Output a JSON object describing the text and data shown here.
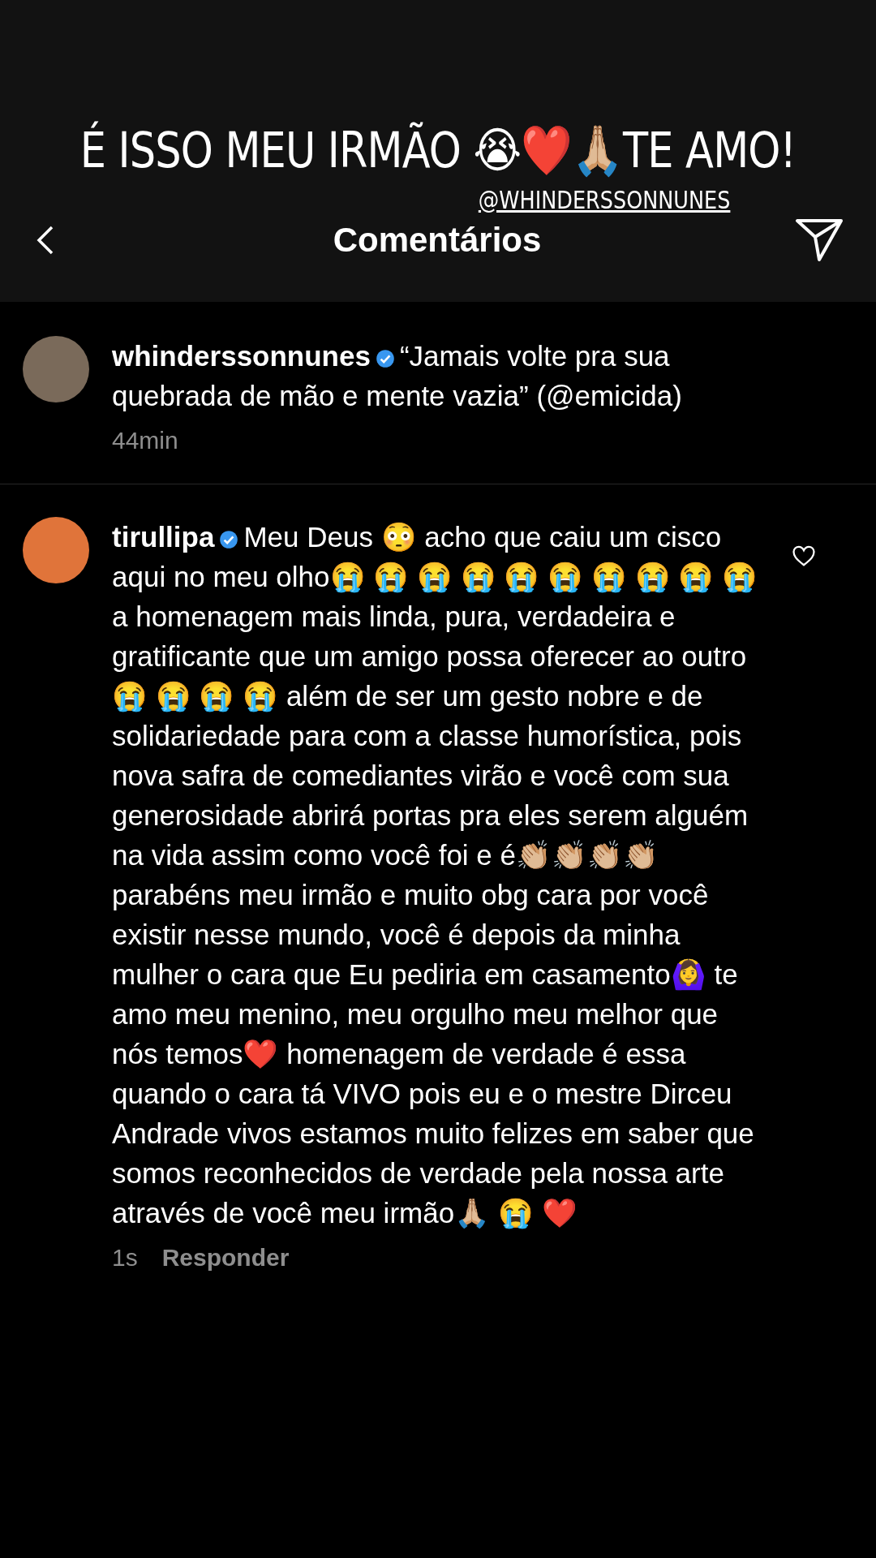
{
  "story": {
    "caption": "É ISSO MEU IRMÃO 😭❤️🙏🏼TE AMO!",
    "mention": "@WHINDERSSONNUNES"
  },
  "header": {
    "title": "Comentários"
  },
  "comments": [
    {
      "username": "whinderssonnunes",
      "verified": true,
      "text": "“Jamais volte pra sua quebrada de mão e mente vazia” (@emicida)",
      "time": "44min"
    },
    {
      "username": "tirullipa",
      "verified": true,
      "text": "Meu Deus 😳 acho que caiu um cisco aqui no meu olho😭 😭 😭 😭 😭 😭 😭 😭 😭 😭 a homenagem mais linda, pura, verdadeira e gratificante que um amigo possa oferecer ao outro😭 😭 😭 😭 além de ser um gesto nobre e de solidariedade para com a classe humorística, pois nova safra de comediantes virão e você com sua generosidade abrirá portas pra eles serem alguém na vida assim como você foi e é👏🏼👏🏼👏🏼👏🏼parabéns meu irmão e muito obg cara por você existir nesse mundo, você é depois da minha mulher o cara que Eu pediria em casamento🙆‍♀️ te amo meu menino, meu orgulho meu melhor que nós temos❤️ homenagem de verdade é essa quando o cara tá VIVO pois eu e o mestre Dirceu Andrade vivos estamos muito felizes em saber que somos reconhecidos de verdade pela nossa arte através de você meu irmão🙏🏼 😭 ❤️",
      "time": "1s",
      "reply": "Responder",
      "liked": false
    }
  ]
}
